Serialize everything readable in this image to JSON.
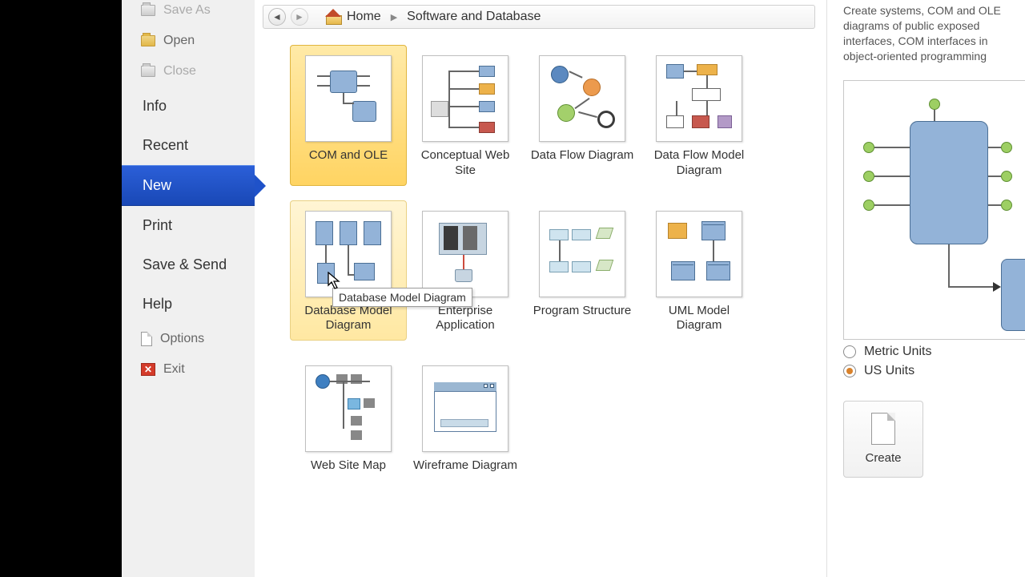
{
  "sidebar": {
    "save_as": "Save As",
    "open": "Open",
    "close": "Close",
    "info": "Info",
    "recent": "Recent",
    "new": "New",
    "print": "Print",
    "save_send": "Save & Send",
    "help": "Help",
    "options": "Options",
    "exit": "Exit"
  },
  "breadcrumb": {
    "home": "Home",
    "category": "Software and Database"
  },
  "templates": [
    {
      "label": "COM and OLE"
    },
    {
      "label": "Conceptual Web Site"
    },
    {
      "label": "Data Flow Diagram"
    },
    {
      "label": "Data Flow Model Diagram"
    },
    {
      "label": "Database Model Diagram"
    },
    {
      "label": "Enterprise Application"
    },
    {
      "label": "Program Structure"
    },
    {
      "label": "UML Model Diagram"
    },
    {
      "label": "Web Site Map"
    },
    {
      "label": "Wireframe Diagram"
    }
  ],
  "tooltip": "Database Model Diagram",
  "right": {
    "description": "Create systems, COM and OLE diagrams of public exposed interfaces, COM interfaces in object-oriented programming",
    "metric": "Metric Units",
    "us": "US Units",
    "create": "Create"
  }
}
